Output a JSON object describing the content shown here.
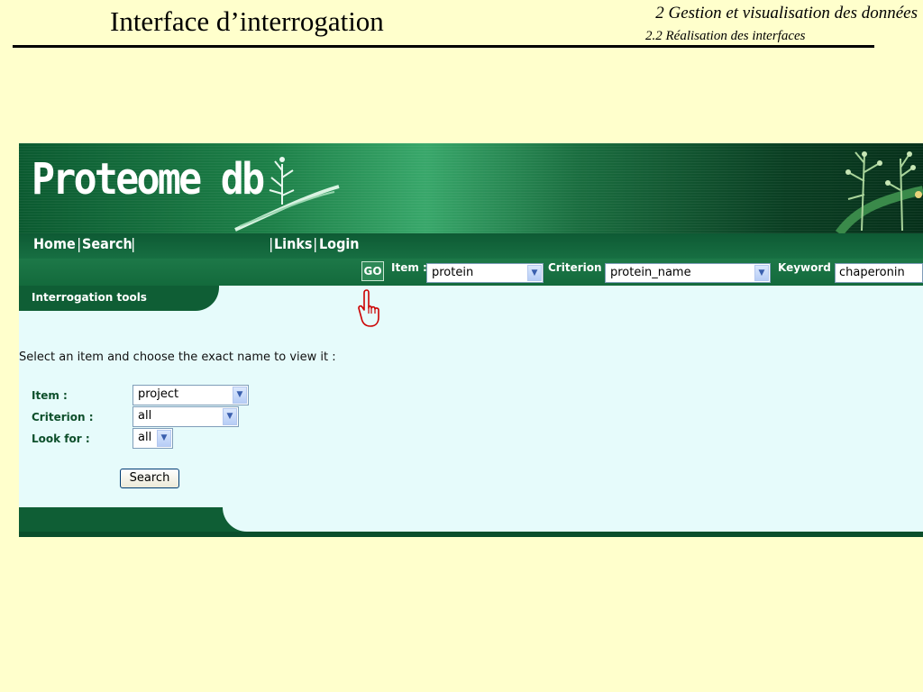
{
  "slide": {
    "title": "Interface d’interrogation",
    "section": "2 Gestion et visualisation des données",
    "subsection": "2.2 Réalisation des interfaces"
  },
  "app": {
    "logo": "Proteome db",
    "nav": {
      "home": "Home",
      "search": "Search",
      "links": "Links",
      "login": "Login",
      "separator": "|"
    },
    "searchbar": {
      "go_label": "GO",
      "item_label": "Item :",
      "item_value": "protein",
      "criterion_label": "Criterion :",
      "criterion_value": "protein_name",
      "keyword_label": "Keyword :",
      "keyword_value": "chaperonin"
    },
    "tools_title": "Interrogation tools",
    "instructions": "Select an item and choose the exact name to view it :",
    "form": {
      "item_label": "Item :",
      "item_value": "project",
      "criterion_label": "Criterion :",
      "criterion_value": "all",
      "lookfor_label": "Look for :",
      "lookfor_value": "all",
      "search_button": "Search"
    },
    "colors": {
      "dark_green": "#0f5e35",
      "mid_green": "#1d7848",
      "panel_bg": "#e6fbfb",
      "slide_bg": "#ffffcc",
      "pointer_red": "#cc0000"
    }
  },
  "icons": {
    "pointer": "pointing-hand-icon",
    "dropdown": "chevron-down-icon"
  }
}
